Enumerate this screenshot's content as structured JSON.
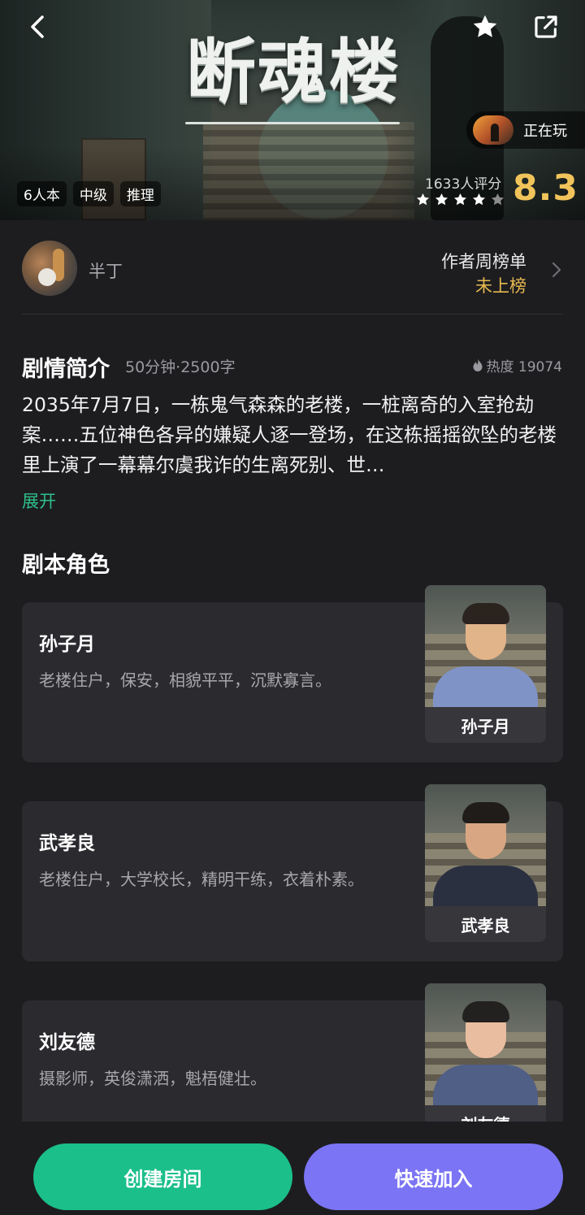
{
  "hero": {
    "title": "断魂楼",
    "tags": [
      "6人本",
      "中级",
      "推理"
    ],
    "playing_label": "正在玩",
    "rating_count": "1633人评分",
    "rating_score": "8.3",
    "stars_filled": 4,
    "stars_total": 5
  },
  "author": {
    "name": "半丁",
    "rank_label": "作者周榜单",
    "rank_value": "未上榜"
  },
  "synopsis": {
    "title": "剧情简介",
    "meta": "50分钟·2500字",
    "heat": "热度 19074",
    "body": "2035年7月7日，一栋鬼气森森的老楼，一桩离奇的入室抢劫案……五位神色各异的嫌疑人逐一登场，在这栋摇摇欲坠的老楼里上演了一幕幕尔虞我诈的生离死别、世…",
    "expand": "展开"
  },
  "roles": {
    "title": "剧本角色",
    "items": [
      {
        "name": "孙子月",
        "desc": "老楼住户，保安，相貌平平，沉默寡言。",
        "portrait_label": "孙子月"
      },
      {
        "name": "武孝良",
        "desc": "老楼住户，大学校长，精明干练，衣着朴素。",
        "portrait_label": "武孝良"
      },
      {
        "name": "刘友德",
        "desc": "摄影师，英俊潇洒，魁梧健壮。",
        "portrait_label": "刘友德"
      }
    ]
  },
  "actions": {
    "create_room": "创建房间",
    "quick_join": "快速加入"
  },
  "colors": {
    "background": "#1d1d20",
    "card": "#2b2b2f",
    "accent_green": "#1bbf8a",
    "accent_purple": "#7b74f4",
    "rating_gold": "#f1c45b",
    "expand_green": "#2fbf8a"
  },
  "icons": [
    "back-icon",
    "star-icon",
    "share-icon",
    "chevron-right-icon",
    "flame-icon"
  ]
}
